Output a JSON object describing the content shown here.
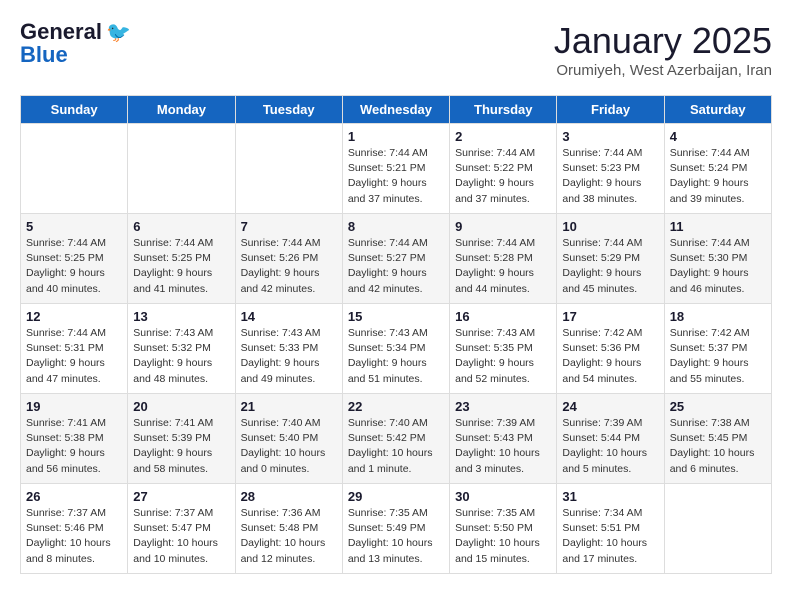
{
  "header": {
    "logo_line1": "General",
    "logo_line2": "Blue",
    "month_title": "January 2025",
    "subtitle": "Orumiyeh, West Azerbaijan, Iran"
  },
  "days_of_week": [
    "Sunday",
    "Monday",
    "Tuesday",
    "Wednesday",
    "Thursday",
    "Friday",
    "Saturday"
  ],
  "weeks": [
    [
      {
        "day": "",
        "info": ""
      },
      {
        "day": "",
        "info": ""
      },
      {
        "day": "",
        "info": ""
      },
      {
        "day": "1",
        "info": "Sunrise: 7:44 AM\nSunset: 5:21 PM\nDaylight: 9 hours\nand 37 minutes."
      },
      {
        "day": "2",
        "info": "Sunrise: 7:44 AM\nSunset: 5:22 PM\nDaylight: 9 hours\nand 37 minutes."
      },
      {
        "day": "3",
        "info": "Sunrise: 7:44 AM\nSunset: 5:23 PM\nDaylight: 9 hours\nand 38 minutes."
      },
      {
        "day": "4",
        "info": "Sunrise: 7:44 AM\nSunset: 5:24 PM\nDaylight: 9 hours\nand 39 minutes."
      }
    ],
    [
      {
        "day": "5",
        "info": "Sunrise: 7:44 AM\nSunset: 5:25 PM\nDaylight: 9 hours\nand 40 minutes."
      },
      {
        "day": "6",
        "info": "Sunrise: 7:44 AM\nSunset: 5:25 PM\nDaylight: 9 hours\nand 41 minutes."
      },
      {
        "day": "7",
        "info": "Sunrise: 7:44 AM\nSunset: 5:26 PM\nDaylight: 9 hours\nand 42 minutes."
      },
      {
        "day": "8",
        "info": "Sunrise: 7:44 AM\nSunset: 5:27 PM\nDaylight: 9 hours\nand 42 minutes."
      },
      {
        "day": "9",
        "info": "Sunrise: 7:44 AM\nSunset: 5:28 PM\nDaylight: 9 hours\nand 44 minutes."
      },
      {
        "day": "10",
        "info": "Sunrise: 7:44 AM\nSunset: 5:29 PM\nDaylight: 9 hours\nand 45 minutes."
      },
      {
        "day": "11",
        "info": "Sunrise: 7:44 AM\nSunset: 5:30 PM\nDaylight: 9 hours\nand 46 minutes."
      }
    ],
    [
      {
        "day": "12",
        "info": "Sunrise: 7:44 AM\nSunset: 5:31 PM\nDaylight: 9 hours\nand 47 minutes."
      },
      {
        "day": "13",
        "info": "Sunrise: 7:43 AM\nSunset: 5:32 PM\nDaylight: 9 hours\nand 48 minutes."
      },
      {
        "day": "14",
        "info": "Sunrise: 7:43 AM\nSunset: 5:33 PM\nDaylight: 9 hours\nand 49 minutes."
      },
      {
        "day": "15",
        "info": "Sunrise: 7:43 AM\nSunset: 5:34 PM\nDaylight: 9 hours\nand 51 minutes."
      },
      {
        "day": "16",
        "info": "Sunrise: 7:43 AM\nSunset: 5:35 PM\nDaylight: 9 hours\nand 52 minutes."
      },
      {
        "day": "17",
        "info": "Sunrise: 7:42 AM\nSunset: 5:36 PM\nDaylight: 9 hours\nand 54 minutes."
      },
      {
        "day": "18",
        "info": "Sunrise: 7:42 AM\nSunset: 5:37 PM\nDaylight: 9 hours\nand 55 minutes."
      }
    ],
    [
      {
        "day": "19",
        "info": "Sunrise: 7:41 AM\nSunset: 5:38 PM\nDaylight: 9 hours\nand 56 minutes."
      },
      {
        "day": "20",
        "info": "Sunrise: 7:41 AM\nSunset: 5:39 PM\nDaylight: 9 hours\nand 58 minutes."
      },
      {
        "day": "21",
        "info": "Sunrise: 7:40 AM\nSunset: 5:40 PM\nDaylight: 10 hours\nand 0 minutes."
      },
      {
        "day": "22",
        "info": "Sunrise: 7:40 AM\nSunset: 5:42 PM\nDaylight: 10 hours\nand 1 minute."
      },
      {
        "day": "23",
        "info": "Sunrise: 7:39 AM\nSunset: 5:43 PM\nDaylight: 10 hours\nand 3 minutes."
      },
      {
        "day": "24",
        "info": "Sunrise: 7:39 AM\nSunset: 5:44 PM\nDaylight: 10 hours\nand 5 minutes."
      },
      {
        "day": "25",
        "info": "Sunrise: 7:38 AM\nSunset: 5:45 PM\nDaylight: 10 hours\nand 6 minutes."
      }
    ],
    [
      {
        "day": "26",
        "info": "Sunrise: 7:37 AM\nSunset: 5:46 PM\nDaylight: 10 hours\nand 8 minutes."
      },
      {
        "day": "27",
        "info": "Sunrise: 7:37 AM\nSunset: 5:47 PM\nDaylight: 10 hours\nand 10 minutes."
      },
      {
        "day": "28",
        "info": "Sunrise: 7:36 AM\nSunset: 5:48 PM\nDaylight: 10 hours\nand 12 minutes."
      },
      {
        "day": "29",
        "info": "Sunrise: 7:35 AM\nSunset: 5:49 PM\nDaylight: 10 hours\nand 13 minutes."
      },
      {
        "day": "30",
        "info": "Sunrise: 7:35 AM\nSunset: 5:50 PM\nDaylight: 10 hours\nand 15 minutes."
      },
      {
        "day": "31",
        "info": "Sunrise: 7:34 AM\nSunset: 5:51 PM\nDaylight: 10 hours\nand 17 minutes."
      },
      {
        "day": "",
        "info": ""
      }
    ]
  ]
}
